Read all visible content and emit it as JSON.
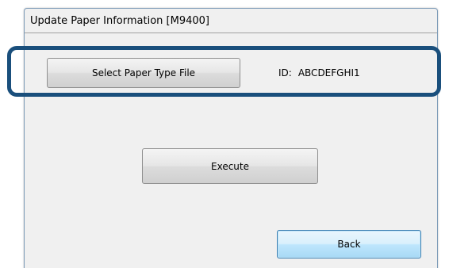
{
  "dialog": {
    "title": "Update Paper Information [M9400]"
  },
  "paper_type": {
    "select_button_label": "Select Paper Type File",
    "id_label": "ID:",
    "id_value": "ABCDEFGHI1"
  },
  "actions": {
    "execute_label": "Execute",
    "back_label": "Back"
  },
  "annotation": {
    "highlight_color": "#1a4f7c"
  }
}
